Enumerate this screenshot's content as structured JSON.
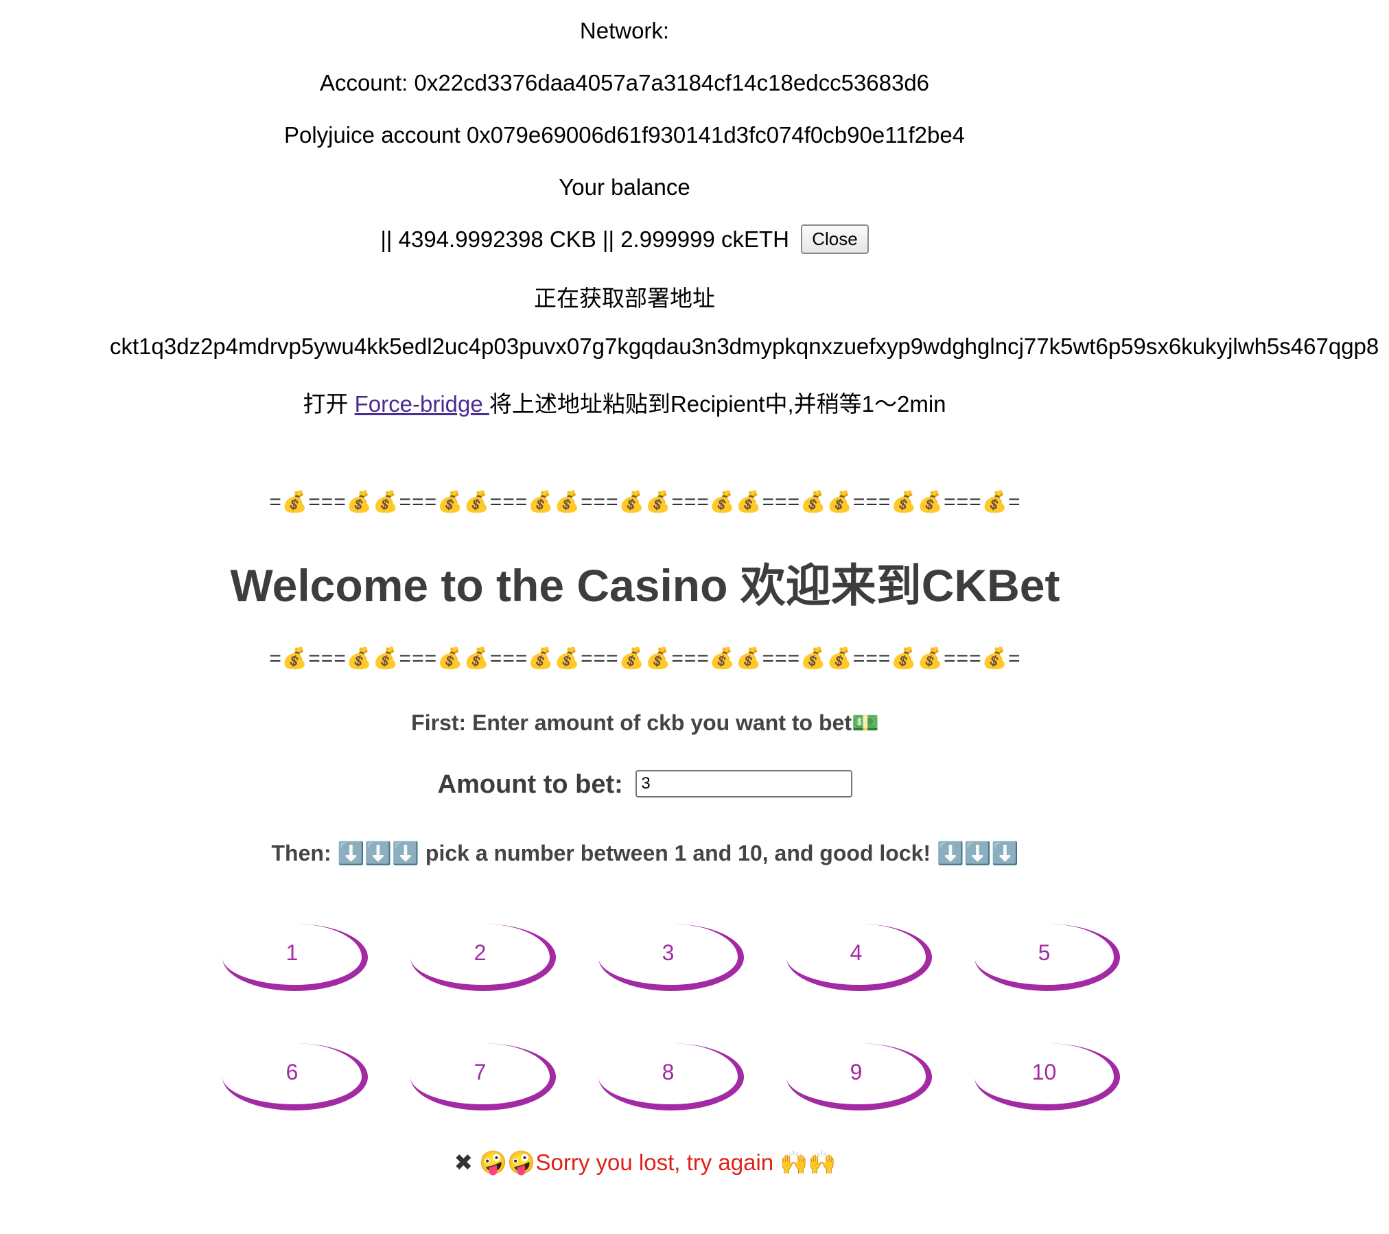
{
  "header": {
    "network_label": "Network:",
    "account_line": "Account: 0x22cd3376daa4057a7a3184cf14c18edcc53683d6",
    "polyjuice_line": "Polyjuice account 0x079e69006d61f930141d3fc074f0cb90e11f2be4",
    "balance_title": "Your balance",
    "balance_text": "|| 4394.9992398 CKB || 2.999999 ckETH",
    "close_label": "Close",
    "deploy_status": "正在获取部署地址",
    "ckb_address": "ckt1q3dz2p4mdrvp5ywu4kk5edl2uc4p03puvx07g7kgqdau3n3dmypkqnxzuefxyp9wdghglncj77k5wt6p59sx6kukyjlwh5s467qgp8",
    "bridge_prefix": "打开 ",
    "bridge_link": "Force-bridge ",
    "bridge_suffix": "将上述地址粘贴到Recipient中,并稍等1～2min"
  },
  "casino": {
    "divider": "=💰===💰💰===💰💰===💰💰===💰💰===💰💰===💰💰===💰💰===💰=",
    "title": "Welcome to the Casino 欢迎来到CKBet",
    "first_step": "First: Enter amount of ckb you want to bet💵",
    "amount_label": "Amount to bet:",
    "amount_value": "3",
    "then_step": "Then: ⬇️⬇️⬇️ pick a number between 1 and 10, and good lock! ⬇️⬇️⬇️",
    "numbers": [
      "1",
      "2",
      "3",
      "4",
      "5",
      "6",
      "7",
      "8",
      "9",
      "10"
    ],
    "accent_color": "#a32aa3",
    "result_icon": "✖",
    "result_message": " 🤪🤪Sorry you lost, try again 🙌🙌",
    "result_color": "#e0201a"
  }
}
